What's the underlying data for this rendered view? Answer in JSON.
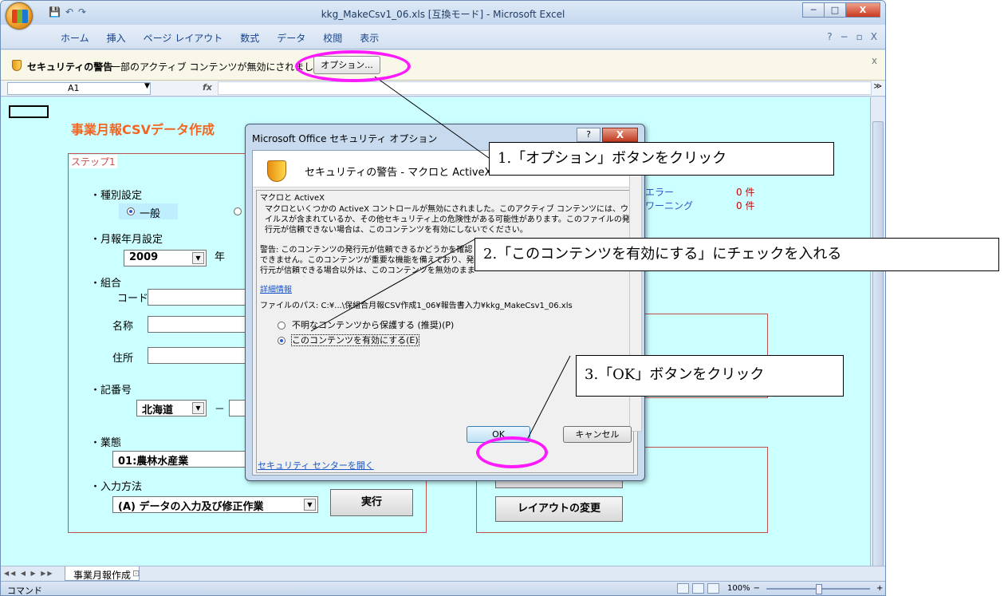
{
  "window": {
    "title": "kkg_MakeCsv1_06.xls [互換モード] - Microsoft Excel",
    "qat_icons": [
      "save-icon",
      "undo-icon",
      "redo-icon"
    ],
    "buttons": [
      "─",
      "□",
      "X"
    ]
  },
  "ribbon": {
    "tabs": [
      "ホーム",
      "挿入",
      "ページ レイアウト",
      "数式",
      "データ",
      "校閲",
      "表示"
    ],
    "right_controls": [
      "?",
      "−",
      "▫",
      "X"
    ]
  },
  "security_bar": {
    "title": "セキュリティの警告",
    "message": "一部のアクティブ コンテンツが無効にされました。",
    "options_button": "オプション...",
    "close": "x"
  },
  "formula_bar": {
    "cell_ref": "A1",
    "fx": "fx",
    "value": ""
  },
  "sheet": {
    "form_title": "事業月報CSVデータ作成",
    "step1": "ステップ1",
    "kind_label": "・種別設定",
    "kind_options": [
      "一般"
    ],
    "kind_selected": "一般",
    "date_label": "・月報年月設定",
    "year_value": "2009",
    "year_suffix": "年",
    "union_label": "・組合",
    "code_label": "コード",
    "name_label": "名称",
    "address_label": "住所",
    "record_label": "・記番号",
    "prefecture": "北海道",
    "dash": "－",
    "business_label": "・業態",
    "business_value": "01:農林水産業",
    "input_label": "・入力方法",
    "input_value": "(A) データの入力及び修正作業",
    "run_button": "実行",
    "layout_button": "レイアウトの変更",
    "results": [
      {
        "label": "エラー",
        "count": "0 件"
      },
      {
        "label": "ワーニング",
        "count": "0 件"
      }
    ]
  },
  "sheet_tabs": {
    "nav": "◀◀ ◀ ▶ ▶▶",
    "active": "事業月報作成"
  },
  "status": {
    "mode": "コマンド",
    "zoom": "100%",
    "minus": "−",
    "plus": "+"
  },
  "dialog": {
    "title": "Microsoft Office セキュリティ オプション",
    "help": "?",
    "close": "X",
    "heading": "セキュリティの警告 - マクロと ActiveX",
    "group_title": "マクロと ActiveX",
    "para1": "マクロといくつかの ActiveX コントロールが無効にされました。このアクティブ コンテンツには、ウイルスが含まれているか、その他セキュリティ上の危険性がある可能性があります。このファイルの発行元が信頼できない場合は、このコンテンツを有効にしないでください。",
    "para2": "警告: このコンテンツの発行元が信頼できるかどうかを確認できません。このコンテンツが重要な機能を備えており、発行元が信頼できる場合以外は、このコンテンツを無効のままにしてください。",
    "more_info": "詳細情報",
    "path": "ファイルのパス:  C:¥...\\保組合月報CSV作成1_06¥報告書入力¥kkg_MakeCsv1_06.xls",
    "option_protect": "不明なコンテンツから保護する (推奨)(P)",
    "option_enable": "このコンテンツを有効にする(E)",
    "trust_link": "セキュリティ センターを開く",
    "ok": "OK",
    "cancel": "キャンセル"
  },
  "annotations": {
    "step1": "1.「オプション」ボタンをクリック",
    "step2": "2.「このコンテンツを有効にする」にチェックを入れる",
    "step3": "3.「OK」ボタンをクリック",
    "highlight_color": "#ff19ff"
  }
}
